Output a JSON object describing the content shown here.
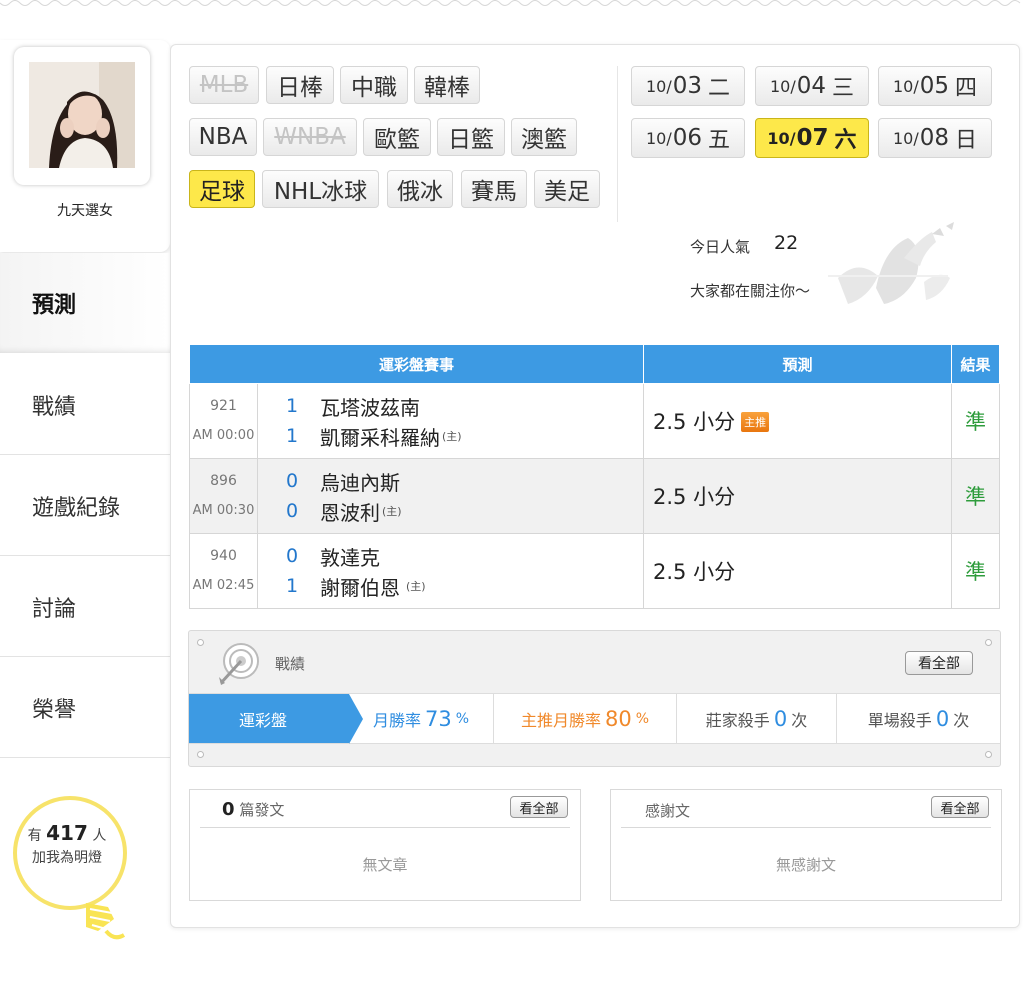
{
  "profile": {
    "name": "九天選女"
  },
  "nav": [
    {
      "label": "預測",
      "active": true
    },
    {
      "label": "戰績",
      "active": false
    },
    {
      "label": "遊戲紀錄",
      "active": false
    },
    {
      "label": "討論",
      "active": false
    },
    {
      "label": "榮譽",
      "active": false
    }
  ],
  "fans": {
    "prefix": "有",
    "count": "417",
    "suffix": "人",
    "line2": "加我為明燈"
  },
  "sports": [
    {
      "label": "MLB",
      "state": "disabled"
    },
    {
      "label": "日棒",
      "state": "normal"
    },
    {
      "label": "中職",
      "state": "normal"
    },
    {
      "label": "韓棒",
      "state": "normal"
    },
    {
      "label": "NBA",
      "state": "normal"
    },
    {
      "label": "WNBA",
      "state": "disabled"
    },
    {
      "label": "歐籃",
      "state": "normal"
    },
    {
      "label": "日籃",
      "state": "normal"
    },
    {
      "label": "澳籃",
      "state": "normal"
    },
    {
      "label": "足球",
      "state": "active"
    },
    {
      "label": "NHL冰球",
      "state": "normal"
    },
    {
      "label": "俄冰",
      "state": "normal"
    },
    {
      "label": "賽馬",
      "state": "normal"
    },
    {
      "label": "美足",
      "state": "normal"
    }
  ],
  "dates": [
    {
      "month": "10/",
      "day": "03",
      "weekday": "二",
      "active": false
    },
    {
      "month": "10/",
      "day": "04",
      "weekday": "三",
      "active": false
    },
    {
      "month": "10/",
      "day": "05",
      "weekday": "四",
      "active": false
    },
    {
      "month": "10/",
      "day": "06",
      "weekday": "五",
      "active": false
    },
    {
      "month": "10/",
      "day": "07",
      "weekday": "六",
      "active": true
    },
    {
      "month": "10/",
      "day": "08",
      "weekday": "日",
      "active": false
    }
  ],
  "popularity": {
    "label": "今日人氣",
    "value": "22",
    "subtitle": "大家都在關注你～"
  },
  "table": {
    "headers": {
      "game": "運彩盤賽事",
      "prediction": "預測",
      "result": "結果"
    },
    "home_mark": "(主)",
    "main_badge": "主推",
    "rows": [
      {
        "num": "921",
        "time": "AM 00:00",
        "away_score": "1",
        "away": "瓦塔波茲南",
        "home_score": "1",
        "home": "凱爾采科羅納",
        "prediction": "2.5 小分",
        "main_pick": true,
        "result": "準"
      },
      {
        "num": "896",
        "time": "AM 00:30",
        "away_score": "0",
        "away": "烏迪內斯",
        "home_score": "0",
        "home": "恩波利",
        "prediction": "2.5 小分",
        "main_pick": false,
        "result": "準"
      },
      {
        "num": "940",
        "time": "AM 02:45",
        "away_score": "0",
        "away": "敦達克",
        "home_score": "1",
        "home": "謝爾伯恩",
        "prediction": "2.5 小分",
        "main_pick": false,
        "result": "準"
      }
    ]
  },
  "record": {
    "title": "戰績",
    "view_all": "看全部",
    "tab": "運彩盤",
    "monthly_label": "月勝率",
    "monthly_value": "73",
    "main_label": "主推月勝率",
    "main_value": "80",
    "percent": "%",
    "dealer_label": "莊家殺手",
    "dealer_value": "0",
    "single_label": "單場殺手",
    "single_value": "0",
    "times": "次"
  },
  "posts": {
    "count": "0",
    "label": "篇發文",
    "view_all": "看全部",
    "empty": "無文章"
  },
  "thanks": {
    "title": "感謝文",
    "view_all": "看全部",
    "empty": "無感謝文"
  },
  "colors": {
    "accent_blue": "#3d9ae3",
    "active_yellow": "#fde84a",
    "result_green": "#2e9c3c",
    "main_orange": "#f0892b"
  }
}
